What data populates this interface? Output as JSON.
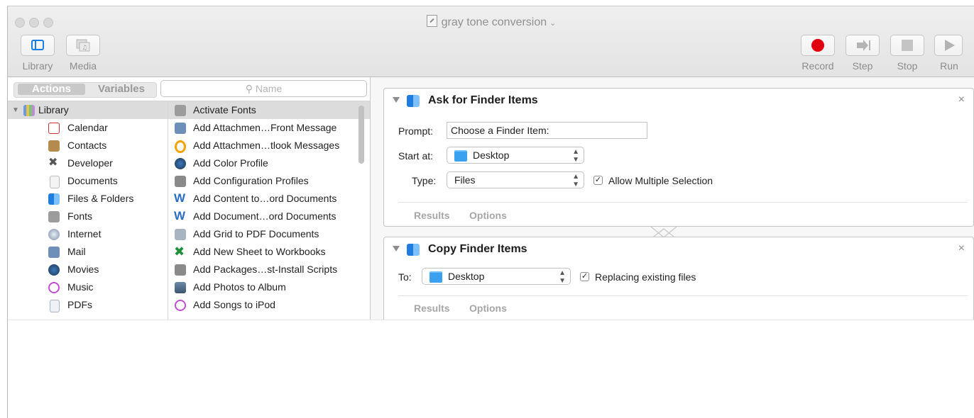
{
  "window": {
    "title": "gray tone conversion"
  },
  "toolbar": {
    "library_label": "Library",
    "media_label": "Media",
    "record_label": "Record",
    "step_label": "Step",
    "stop_label": "Stop",
    "run_label": "Run"
  },
  "sidebar": {
    "tab_actions": "Actions",
    "tab_variables": "Variables",
    "search_placeholder": "Name",
    "library": [
      {
        "label": "Library",
        "icon": "library-icon"
      },
      {
        "label": "Calendar",
        "icon": "calendar-icon"
      },
      {
        "label": "Contacts",
        "icon": "contacts-icon"
      },
      {
        "label": "Developer",
        "icon": "developer-icon"
      },
      {
        "label": "Documents",
        "icon": "documents-icon"
      },
      {
        "label": "Files & Folders",
        "icon": "finder-icon"
      },
      {
        "label": "Fonts",
        "icon": "fonts-icon"
      },
      {
        "label": "Internet",
        "icon": "internet-icon"
      },
      {
        "label": "Mail",
        "icon": "mail-icon"
      },
      {
        "label": "Movies",
        "icon": "movies-icon"
      },
      {
        "label": "Music",
        "icon": "music-icon"
      },
      {
        "label": "PDFs",
        "icon": "pdf-icon"
      }
    ],
    "actions": [
      {
        "label": "Activate Fonts",
        "icon": "fonts-icon"
      },
      {
        "label": "Add Attachmen…Front Message",
        "icon": "mail-icon"
      },
      {
        "label": "Add Attachmen…tlook Messages",
        "icon": "outlook-icon"
      },
      {
        "label": "Add Color Profile",
        "icon": "preview-icon"
      },
      {
        "label": "Add Configuration Profiles",
        "icon": "installer-icon"
      },
      {
        "label": "Add Content to…ord Documents",
        "icon": "word-icon"
      },
      {
        "label": "Add Document…ord Documents",
        "icon": "word-icon"
      },
      {
        "label": "Add Grid to PDF Documents",
        "icon": "pdf-icon"
      },
      {
        "label": "Add New Sheet to Workbooks",
        "icon": "excel-icon"
      },
      {
        "label": "Add Packages…st-Install Scripts",
        "icon": "installer-icon"
      },
      {
        "label": "Add Photos to Album",
        "icon": "photos-icon"
      },
      {
        "label": "Add Songs to iPod",
        "icon": "music-icon"
      }
    ]
  },
  "workflow": {
    "ask": {
      "title": "Ask for Finder Items",
      "prompt_label": "Prompt:",
      "prompt_value": "Choose a Finder Item:",
      "start_label": "Start at:",
      "start_value": "Desktop",
      "type_label": "Type:",
      "type_value": "Files",
      "allow_multiple_label": "Allow Multiple Selection",
      "results_tab": "Results",
      "options_tab": "Options"
    },
    "copy": {
      "title": "Copy Finder Items",
      "to_label": "To:",
      "to_value": "Desktop",
      "replacing_label": "Replacing existing files",
      "results_tab": "Results",
      "options_tab": "Options"
    },
    "close_glyph": "×",
    "check_glyph": "✓"
  },
  "colors": {
    "record_red": "#e0000f",
    "selection_gray": "#dcdcdc",
    "finder_blue": "#1f7de0"
  }
}
